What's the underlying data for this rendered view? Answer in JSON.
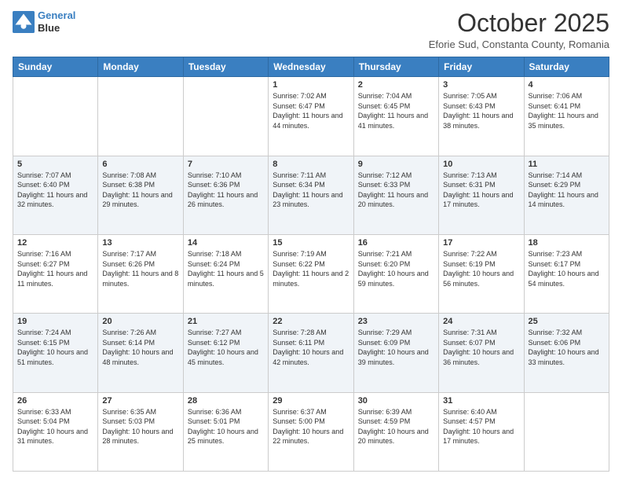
{
  "logo": {
    "line1": "General",
    "line2": "Blue"
  },
  "header": {
    "month": "October 2025",
    "location": "Eforie Sud, Constanta County, Romania"
  },
  "days": [
    "Sunday",
    "Monday",
    "Tuesday",
    "Wednesday",
    "Thursday",
    "Friday",
    "Saturday"
  ],
  "weeks": [
    [
      {
        "date": "",
        "info": ""
      },
      {
        "date": "",
        "info": ""
      },
      {
        "date": "",
        "info": ""
      },
      {
        "date": "1",
        "info": "Sunrise: 7:02 AM\nSunset: 6:47 PM\nDaylight: 11 hours and 44 minutes."
      },
      {
        "date": "2",
        "info": "Sunrise: 7:04 AM\nSunset: 6:45 PM\nDaylight: 11 hours and 41 minutes."
      },
      {
        "date": "3",
        "info": "Sunrise: 7:05 AM\nSunset: 6:43 PM\nDaylight: 11 hours and 38 minutes."
      },
      {
        "date": "4",
        "info": "Sunrise: 7:06 AM\nSunset: 6:41 PM\nDaylight: 11 hours and 35 minutes."
      }
    ],
    [
      {
        "date": "5",
        "info": "Sunrise: 7:07 AM\nSunset: 6:40 PM\nDaylight: 11 hours and 32 minutes."
      },
      {
        "date": "6",
        "info": "Sunrise: 7:08 AM\nSunset: 6:38 PM\nDaylight: 11 hours and 29 minutes."
      },
      {
        "date": "7",
        "info": "Sunrise: 7:10 AM\nSunset: 6:36 PM\nDaylight: 11 hours and 26 minutes."
      },
      {
        "date": "8",
        "info": "Sunrise: 7:11 AM\nSunset: 6:34 PM\nDaylight: 11 hours and 23 minutes."
      },
      {
        "date": "9",
        "info": "Sunrise: 7:12 AM\nSunset: 6:33 PM\nDaylight: 11 hours and 20 minutes."
      },
      {
        "date": "10",
        "info": "Sunrise: 7:13 AM\nSunset: 6:31 PM\nDaylight: 11 hours and 17 minutes."
      },
      {
        "date": "11",
        "info": "Sunrise: 7:14 AM\nSunset: 6:29 PM\nDaylight: 11 hours and 14 minutes."
      }
    ],
    [
      {
        "date": "12",
        "info": "Sunrise: 7:16 AM\nSunset: 6:27 PM\nDaylight: 11 hours and 11 minutes."
      },
      {
        "date": "13",
        "info": "Sunrise: 7:17 AM\nSunset: 6:26 PM\nDaylight: 11 hours and 8 minutes."
      },
      {
        "date": "14",
        "info": "Sunrise: 7:18 AM\nSunset: 6:24 PM\nDaylight: 11 hours and 5 minutes."
      },
      {
        "date": "15",
        "info": "Sunrise: 7:19 AM\nSunset: 6:22 PM\nDaylight: 11 hours and 2 minutes."
      },
      {
        "date": "16",
        "info": "Sunrise: 7:21 AM\nSunset: 6:20 PM\nDaylight: 10 hours and 59 minutes."
      },
      {
        "date": "17",
        "info": "Sunrise: 7:22 AM\nSunset: 6:19 PM\nDaylight: 10 hours and 56 minutes."
      },
      {
        "date": "18",
        "info": "Sunrise: 7:23 AM\nSunset: 6:17 PM\nDaylight: 10 hours and 54 minutes."
      }
    ],
    [
      {
        "date": "19",
        "info": "Sunrise: 7:24 AM\nSunset: 6:15 PM\nDaylight: 10 hours and 51 minutes."
      },
      {
        "date": "20",
        "info": "Sunrise: 7:26 AM\nSunset: 6:14 PM\nDaylight: 10 hours and 48 minutes."
      },
      {
        "date": "21",
        "info": "Sunrise: 7:27 AM\nSunset: 6:12 PM\nDaylight: 10 hours and 45 minutes."
      },
      {
        "date": "22",
        "info": "Sunrise: 7:28 AM\nSunset: 6:11 PM\nDaylight: 10 hours and 42 minutes."
      },
      {
        "date": "23",
        "info": "Sunrise: 7:29 AM\nSunset: 6:09 PM\nDaylight: 10 hours and 39 minutes."
      },
      {
        "date": "24",
        "info": "Sunrise: 7:31 AM\nSunset: 6:07 PM\nDaylight: 10 hours and 36 minutes."
      },
      {
        "date": "25",
        "info": "Sunrise: 7:32 AM\nSunset: 6:06 PM\nDaylight: 10 hours and 33 minutes."
      }
    ],
    [
      {
        "date": "26",
        "info": "Sunrise: 6:33 AM\nSunset: 5:04 PM\nDaylight: 10 hours and 31 minutes."
      },
      {
        "date": "27",
        "info": "Sunrise: 6:35 AM\nSunset: 5:03 PM\nDaylight: 10 hours and 28 minutes."
      },
      {
        "date": "28",
        "info": "Sunrise: 6:36 AM\nSunset: 5:01 PM\nDaylight: 10 hours and 25 minutes."
      },
      {
        "date": "29",
        "info": "Sunrise: 6:37 AM\nSunset: 5:00 PM\nDaylight: 10 hours and 22 minutes."
      },
      {
        "date": "30",
        "info": "Sunrise: 6:39 AM\nSunset: 4:59 PM\nDaylight: 10 hours and 20 minutes."
      },
      {
        "date": "31",
        "info": "Sunrise: 6:40 AM\nSunset: 4:57 PM\nDaylight: 10 hours and 17 minutes."
      },
      {
        "date": "",
        "info": ""
      }
    ]
  ]
}
